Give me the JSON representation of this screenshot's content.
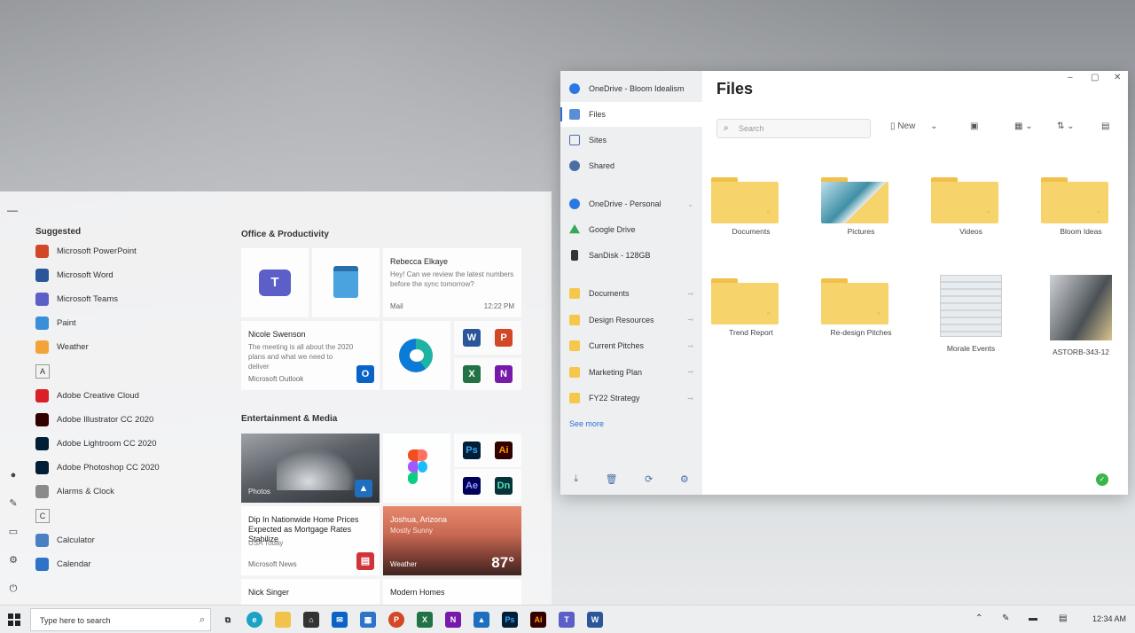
{
  "start_menu": {
    "suggested_label": "Suggested",
    "suggested": [
      {
        "name": "Microsoft PowerPoint",
        "color": "#d24726"
      },
      {
        "name": "Microsoft Word",
        "color": "#2b579a"
      },
      {
        "name": "Microsoft Teams",
        "color": "#5b5fc7"
      },
      {
        "name": "Paint",
        "color": "#3a8fd9"
      },
      {
        "name": "Weather",
        "color": "#f2a33a"
      }
    ],
    "letter_a": "A",
    "apps_a": [
      {
        "name": "Adobe Creative Cloud",
        "color": "#da1f26"
      },
      {
        "name": "Adobe Illustrator CC 2020",
        "color": "#330000"
      },
      {
        "name": "Adobe Lightroom CC 2020",
        "color": "#001e36"
      },
      {
        "name": "Adobe Photoshop CC 2020",
        "color": "#001e36"
      },
      {
        "name": "Alarms & Clock",
        "color": "#8a8a8a"
      }
    ],
    "letter_c": "C",
    "apps_c": [
      {
        "name": "Calculator",
        "color": "#4a7fc1"
      },
      {
        "name": "Calendar",
        "color": "#2e72c9"
      }
    ],
    "office_title": "Office & Productivity",
    "entertainment_title": "Entertainment & Media",
    "tiles": {
      "rebecca_title": "Rebecca Elkaye",
      "rebecca_sub": "Hey! Can we review the latest numbers before the sync tomorrow?",
      "rebecca_foot": "Mail",
      "rebecca_time": "12:22 PM",
      "outlook_title": "Nicole Swenson",
      "outlook_sub": "The meeting is all about the 2020 plans and what we need to deliver",
      "outlook_foot": "Microsoft Outlook",
      "photos_label": "Photos",
      "news_title": "Dip In Nationwide Home Prices Expected as Mortgage Rates Stabilize",
      "news_source": "USA Today",
      "news_foot": "Microsoft News",
      "weather_title": "Joshua, Arizona",
      "weather_sub": "Mostly Sunny",
      "weather_foot": "Weather",
      "weather_temp": "87°",
      "bottom_left": "Nick Singer",
      "bottom_right": "Modern Homes"
    },
    "mini_apps": {
      "word": "W",
      "powerpoint": "P",
      "excel": "X",
      "onenote": "N",
      "photoshop": "Ps",
      "illustrator": "Ai",
      "aftereffects": "Ae",
      "dimension": "Dn"
    }
  },
  "files_window": {
    "title": "Files",
    "account": "OneDrive - Bloom Idealism",
    "nav": [
      {
        "label": "Files",
        "active": true
      },
      {
        "label": "Sites",
        "active": false
      },
      {
        "label": "Shared",
        "active": false
      }
    ],
    "locations": [
      {
        "label": "OneDrive - Personal",
        "color": "#2b78e4"
      },
      {
        "label": "Google Drive",
        "color": "#34a853"
      },
      {
        "label": "SanDisk - 128GB",
        "color": "#333333"
      }
    ],
    "folders_pinned": [
      "Documents",
      "Design Resources",
      "Current Pitches",
      "Marketing Plan",
      "FY22 Strategy"
    ],
    "see_more": "See more",
    "search_placeholder": "Search",
    "new_label": "New",
    "items": [
      {
        "name": "Documents",
        "kind": "folder"
      },
      {
        "name": "Pictures",
        "kind": "photo-folder"
      },
      {
        "name": "Videos",
        "kind": "folder"
      },
      {
        "name": "Bloom Ideas",
        "kind": "folder"
      },
      {
        "name": "Trend Report",
        "kind": "folder"
      },
      {
        "name": "Re-design Pitches",
        "kind": "folder"
      },
      {
        "name": "Morale Events",
        "kind": "screenshot"
      },
      {
        "name": "ASTORB-343-12",
        "kind": "photo"
      }
    ]
  },
  "taskbar": {
    "search_placeholder": "Type here to search",
    "clock": "12:34 AM"
  }
}
